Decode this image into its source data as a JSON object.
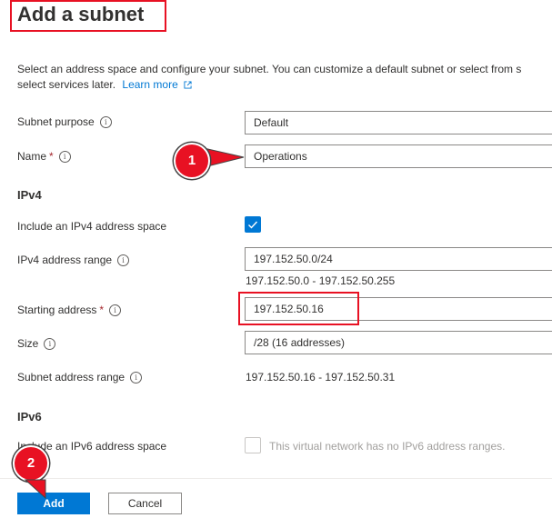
{
  "dialog": {
    "title": "Add a subnet",
    "description_line1": "Select an address space and configure your subnet. You can customize a default subnet or select from s",
    "description_line2": "select services later.",
    "learn_more": "Learn more"
  },
  "form": {
    "subnet_purpose": {
      "label": "Subnet purpose",
      "value": "Default"
    },
    "name": {
      "label": "Name",
      "required_mark": "*",
      "value": "Operations"
    },
    "ipv4_section": "IPv4",
    "include_ipv4": {
      "label": "Include an IPv4 address space",
      "checked": true
    },
    "ipv4_range": {
      "label": "IPv4 address range",
      "value": "197.152.50.0/24",
      "hint": "197.152.50.0 - 197.152.50.255"
    },
    "starting_address": {
      "label": "Starting address",
      "required_mark": "*",
      "value": "197.152.50.16"
    },
    "size": {
      "label": "Size",
      "value": "/28 (16 addresses)"
    },
    "subnet_range": {
      "label": "Subnet address range",
      "value": "197.152.50.16 - 197.152.50.31"
    },
    "ipv6_section": "IPv6",
    "include_ipv6": {
      "label": "Include an IPv6 address space",
      "checked": false,
      "note": "This virtual network has no IPv6 address ranges."
    }
  },
  "footer": {
    "add_label": "Add",
    "cancel_label": "Cancel"
  },
  "callouts": [
    "1",
    "2"
  ],
  "colors": {
    "accent": "#0078d4",
    "annotation": "#e81123",
    "required": "#a4262c"
  },
  "icons": {
    "info": "info-icon",
    "external": "external-link-icon",
    "check": "checkmark-icon"
  }
}
